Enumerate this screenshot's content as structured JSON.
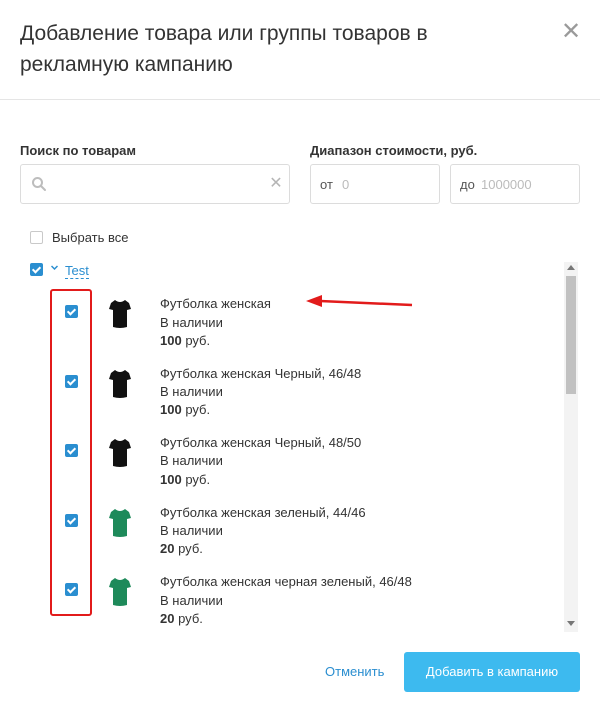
{
  "dialog": {
    "title": "Добавление товара или группы товаров в рекламную кампанию",
    "close_icon": "close-icon"
  },
  "filters": {
    "search_label": "Поиск по товарам",
    "search_value": "",
    "price_label": "Диапазон стоимости, руб.",
    "from_prefix": "от",
    "from_placeholder": "0",
    "to_prefix": "до",
    "to_placeholder": "1000000"
  },
  "select_all": {
    "label": "Выбрать все",
    "checked": false
  },
  "group": {
    "name": "Test",
    "checked": true
  },
  "items": [
    {
      "name": "Футболка женская",
      "stock": "В наличии",
      "price": "100",
      "currency": "руб.",
      "shirt_color": "#111111",
      "checked": true
    },
    {
      "name": "Футболка женская Черный, 46/48",
      "stock": "В наличии",
      "price": "100",
      "currency": "руб.",
      "shirt_color": "#111111",
      "checked": true
    },
    {
      "name": "Футболка женская Черный, 48/50",
      "stock": "В наличии",
      "price": "100",
      "currency": "руб.",
      "shirt_color": "#111111",
      "checked": true
    },
    {
      "name": "Футболка женская зеленый, 44/46",
      "stock": "В наличии",
      "price": "20",
      "currency": "руб.",
      "shirt_color": "#1e8a5a",
      "checked": true
    },
    {
      "name": "Футболка женская черная зеленый, 46/48",
      "stock": "В наличии",
      "price": "20",
      "currency": "руб.",
      "shirt_color": "#1e8a5a",
      "checked": true
    }
  ],
  "footer": {
    "cancel_label": "Отменить",
    "add_label": "Добавить в кампанию"
  },
  "colors": {
    "accent": "#2a8ed0",
    "button": "#3dbaef",
    "highlight": "#e21b1b"
  }
}
